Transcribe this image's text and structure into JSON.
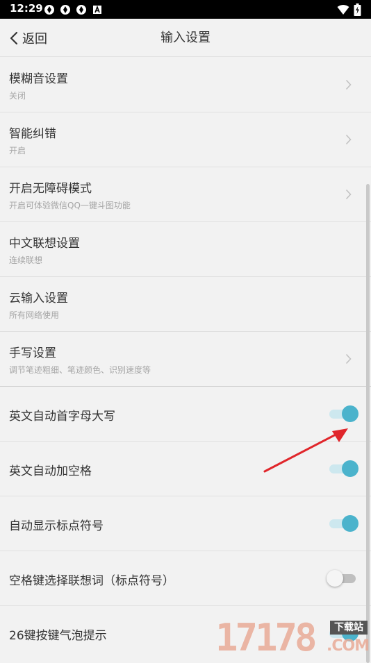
{
  "status_bar": {
    "time": "12:29",
    "left_icons": [
      "app-icon",
      "app-icon",
      "app-icon",
      "a-box-icon"
    ],
    "right_icons": [
      "wifi-icon",
      "battery-icon"
    ]
  },
  "header": {
    "back_label": "返回",
    "title": "输入设置"
  },
  "settings": [
    {
      "title": "模糊音设置",
      "subtitle": "关闭",
      "control": "chevron"
    },
    {
      "title": "智能纠错",
      "subtitle": "开启",
      "control": "chevron"
    },
    {
      "title": "开启无障碍模式",
      "subtitle": "开启可体验微信QQ一键斗图功能",
      "control": "chevron"
    },
    {
      "title": "中文联想设置",
      "subtitle": "连续联想",
      "control": "none"
    },
    {
      "title": "云输入设置",
      "subtitle": "所有网络使用",
      "control": "none"
    },
    {
      "title": "手写设置",
      "subtitle": "调节笔迹粗细、笔迹颜色、识别速度等",
      "control": "chevron"
    },
    {
      "title": "英文自动首字母大写",
      "control": "toggle",
      "on": true
    },
    {
      "title": "英文自动加空格",
      "control": "toggle",
      "on": true
    },
    {
      "title": "自动显示标点符号",
      "control": "toggle",
      "on": true
    },
    {
      "title": "空格键选择联想词（标点符号）",
      "control": "toggle",
      "on": false
    },
    {
      "title": "26键按键气泡提示",
      "control": "toggle",
      "on": true
    }
  ],
  "watermark": {
    "number": "17178",
    "badge": "下载站",
    "domain": ".COM"
  },
  "colors": {
    "toggle_on": "#4bb3cc",
    "toggle_track_on": "#cde8ef",
    "annotation_arrow": "#e0262b"
  }
}
